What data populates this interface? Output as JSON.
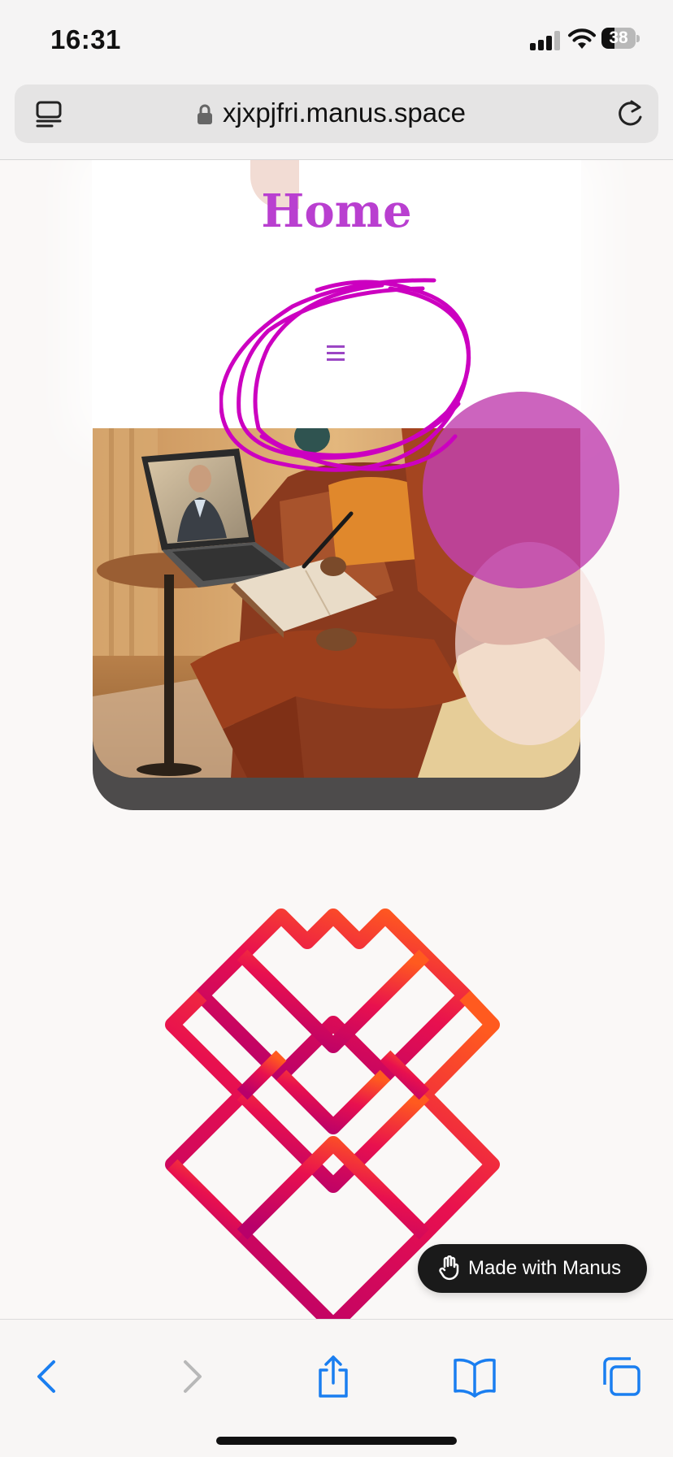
{
  "status": {
    "time": "16:31",
    "battery_percent": "38",
    "battery_level": 0.38
  },
  "browser": {
    "url": "xjxpjfri.manus.space",
    "tabs_icon": "tab-overview-icon",
    "lock_icon": "lock-icon",
    "reload_icon": "reload-icon"
  },
  "page": {
    "title": "Home",
    "menu_icon": "hamburger-menu-icon",
    "hero_image": "woman-journaling-during-video-call-photo",
    "logo": "diamond-lattice-logo",
    "colors": {
      "title": "#b93fd0",
      "annotation": "#cc00c0",
      "accent_circle": "#c142b0",
      "logo_gradient_top": "#ff5a1f",
      "logo_gradient_mid": "#e8104f",
      "logo_gradient_bottom": "#b8006a"
    }
  },
  "badge": {
    "label": "Made with Manus",
    "icon": "manus-hand-icon"
  },
  "toolbar": {
    "back_icon": "chevron-left-icon",
    "forward_icon": "chevron-right-icon",
    "share_icon": "share-icon",
    "bookmarks_icon": "book-icon",
    "tabs_icon": "tabs-icon",
    "accent": "#1a7ef0"
  }
}
